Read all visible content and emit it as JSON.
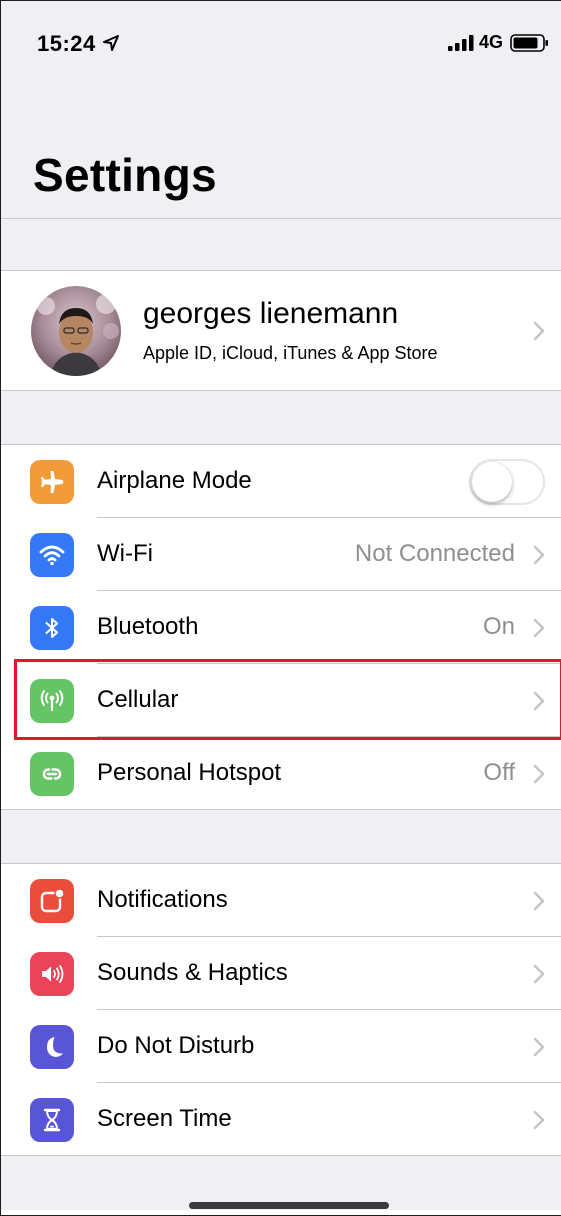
{
  "status_bar": {
    "time": "15:24",
    "network": "4G",
    "location_icon": "location-arrow-icon",
    "signal_icon": "signal-bars-icon",
    "battery_icon": "battery-icon"
  },
  "page": {
    "title": "Settings"
  },
  "profile": {
    "name": "georges lienemann",
    "subtitle": "Apple ID, iCloud, iTunes & App Store",
    "avatar_icon": "avatar-photo"
  },
  "connectivity": [
    {
      "label": "Airplane Mode",
      "value": "",
      "icon": "airplane-icon",
      "color": "#f19a37",
      "toggle": false
    },
    {
      "label": "Wi-Fi",
      "value": "Not Connected",
      "icon": "wifi-icon",
      "color": "#3478f6"
    },
    {
      "label": "Bluetooth",
      "value": "On",
      "icon": "bluetooth-icon",
      "color": "#3478f6"
    },
    {
      "label": "Cellular",
      "value": "",
      "icon": "antenna-icon",
      "color": "#65c466"
    },
    {
      "label": "Personal Hotspot",
      "value": "Off",
      "icon": "hotspot-icon",
      "color": "#65c466"
    }
  ],
  "alerts": [
    {
      "label": "Notifications",
      "icon": "notifications-icon",
      "color": "#eb4d3d"
    },
    {
      "label": "Sounds & Haptics",
      "icon": "speaker-icon",
      "color": "#eb445a"
    },
    {
      "label": "Do Not Disturb",
      "icon": "moon-icon",
      "color": "#5856d6"
    },
    {
      "label": "Screen Time",
      "icon": "hourglass-icon",
      "color": "#5856d6"
    }
  ],
  "highlight": {
    "target": "Cellular",
    "color": "#e0162b"
  }
}
